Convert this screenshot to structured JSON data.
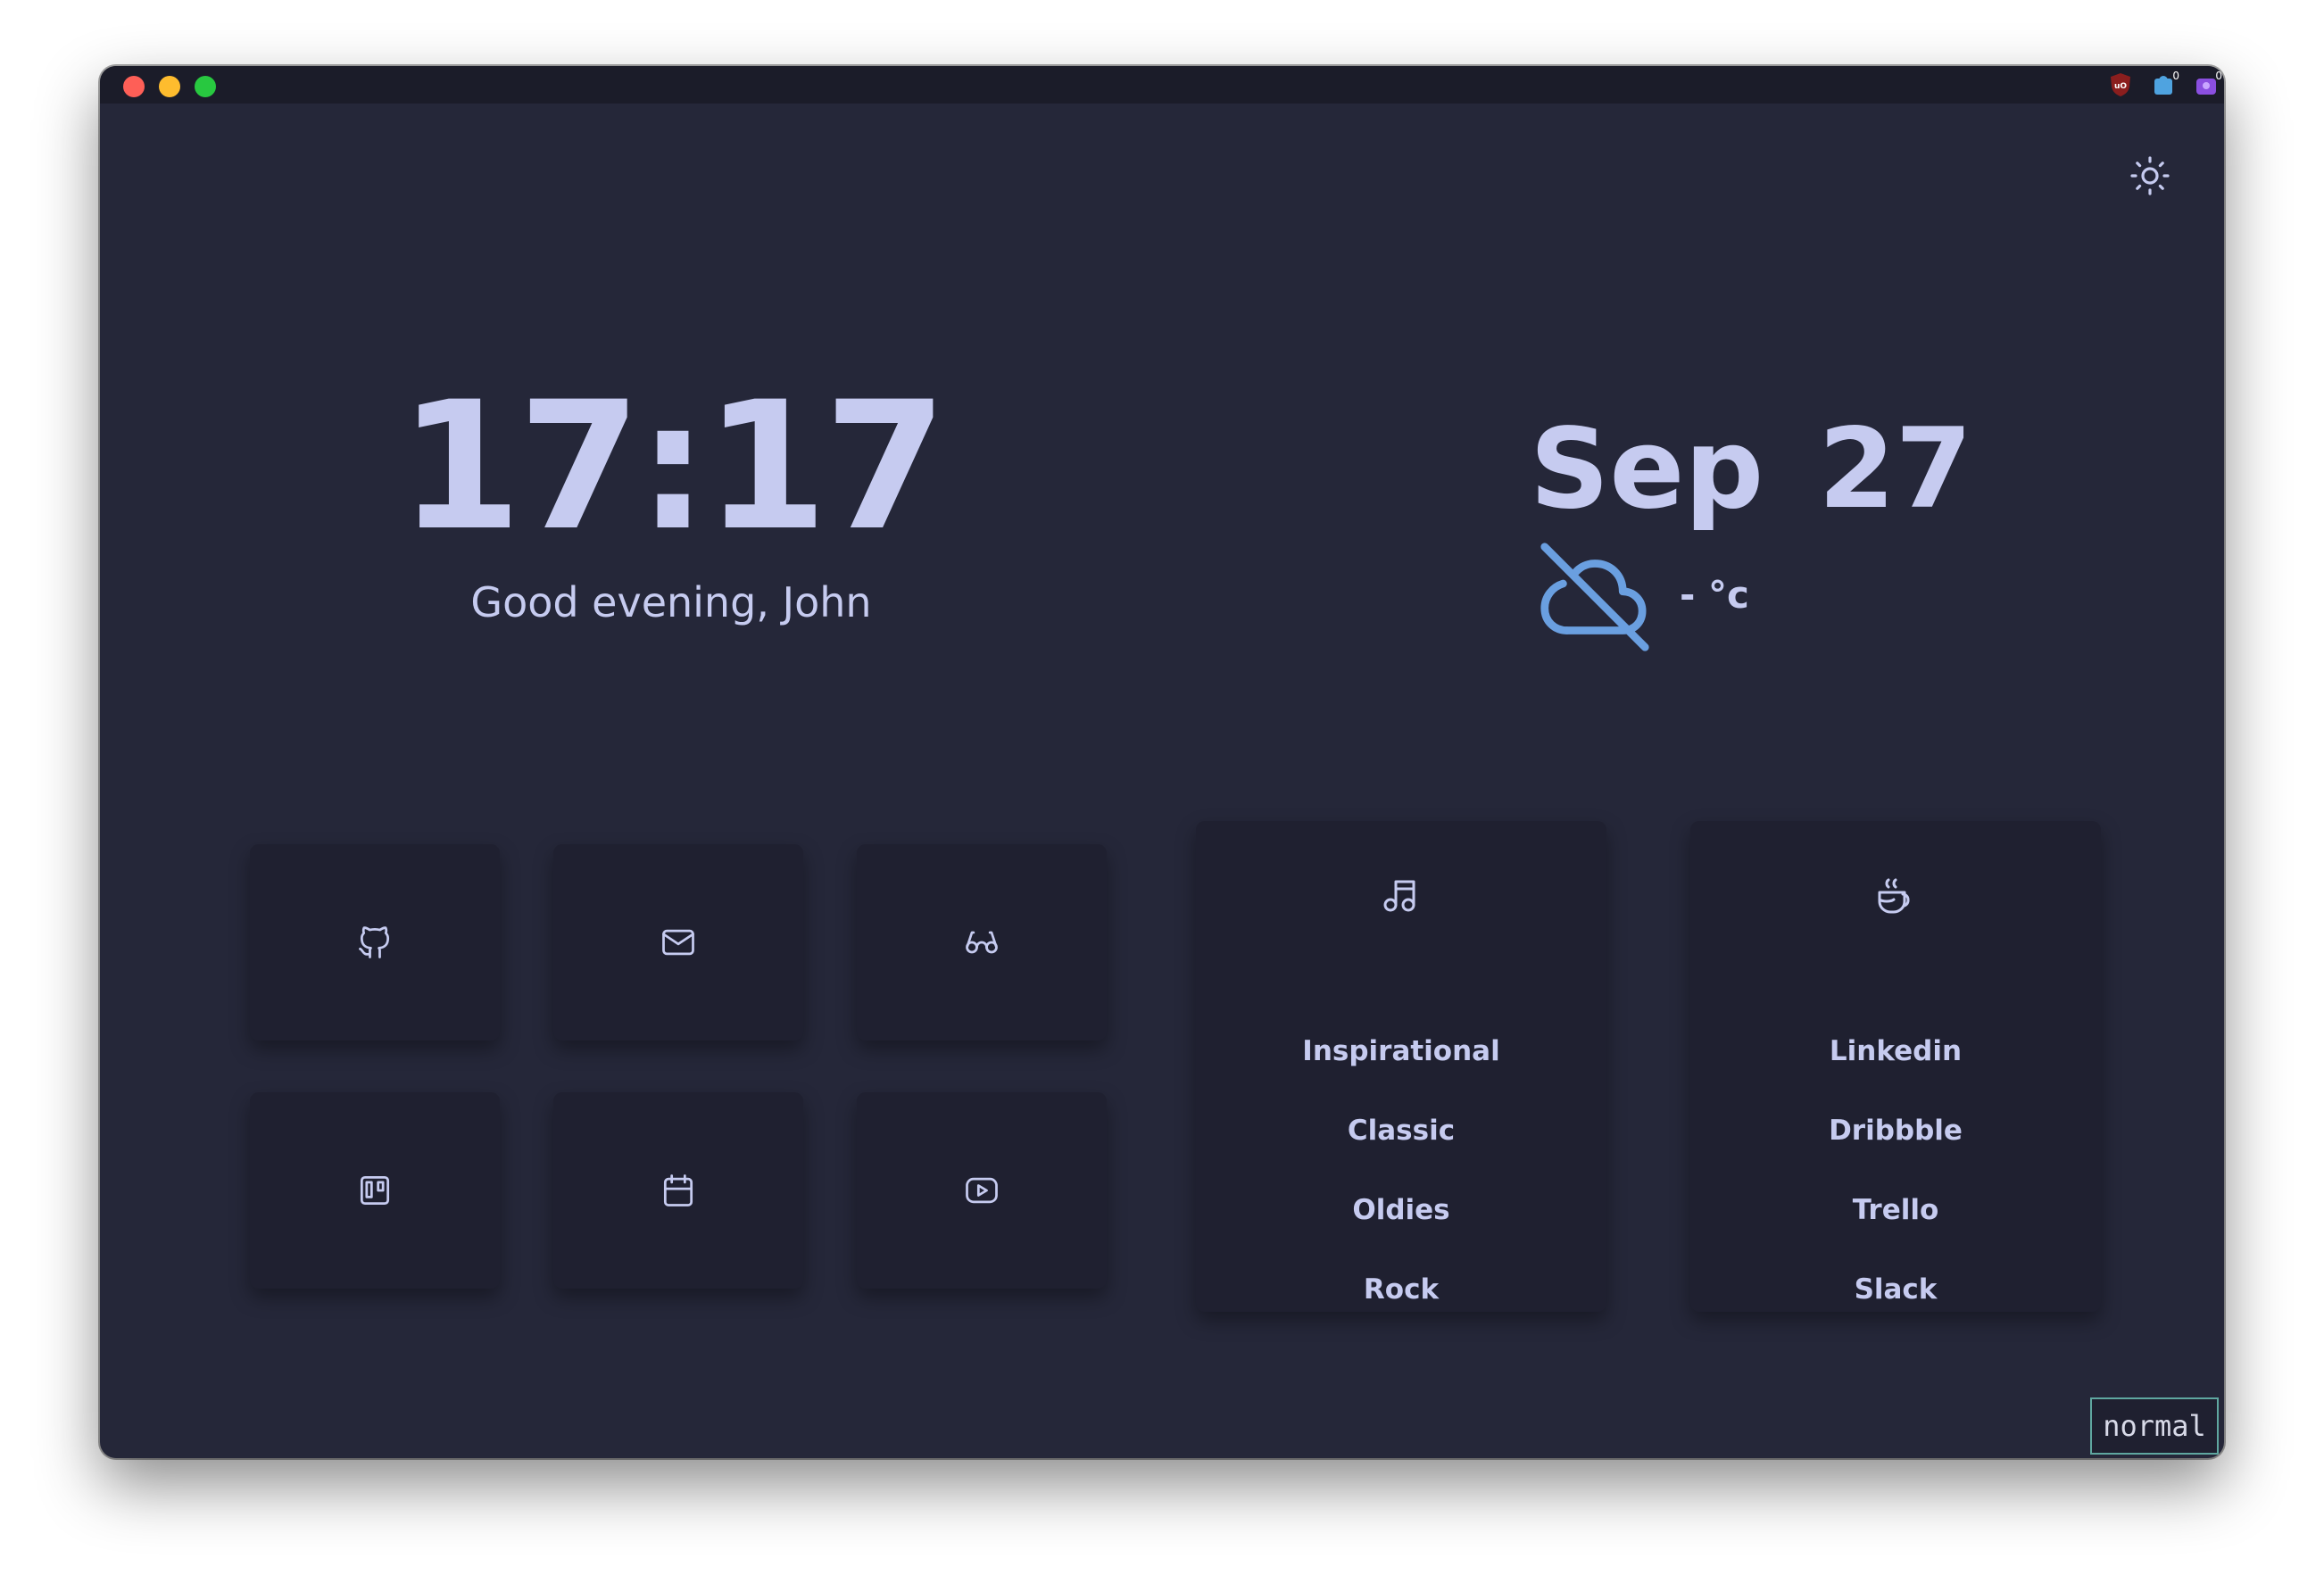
{
  "window": {
    "traffic_lights": [
      "close",
      "minimize",
      "zoom"
    ]
  },
  "extensions": [
    {
      "icon": "ublock-shield-icon",
      "badge": ""
    },
    {
      "icon": "blue-extension-icon",
      "badge": "0"
    },
    {
      "icon": "purple-extension-icon",
      "badge": "0"
    }
  ],
  "theme_toggle": {
    "icon": "sun-icon"
  },
  "clock": {
    "time": "17:17",
    "greeting": "Good evening, John"
  },
  "weather": {
    "date": "Sep 27",
    "icon": "cloud-off-icon",
    "temperature": "- °c"
  },
  "shortcuts": [
    {
      "icon": "github-icon"
    },
    {
      "icon": "mail-icon"
    },
    {
      "icon": "glasses-icon"
    },
    {
      "icon": "trello-icon"
    },
    {
      "icon": "calendar-icon"
    },
    {
      "icon": "youtube-icon"
    }
  ],
  "music_card": {
    "icon": "music-note-icon",
    "items": [
      "Inspirational",
      "Classic",
      "Oldies",
      "Rock"
    ]
  },
  "work_card": {
    "icon": "coffee-cup-icon",
    "items": [
      "Linkedin",
      "Dribbble",
      "Trello",
      "Slack"
    ]
  },
  "mode_indicator": "normal",
  "colors": {
    "background": "#252739",
    "tile": "#1f2030",
    "text": "#c6cbf0",
    "weather_icon": "#6a9fe0",
    "mode_border": "#5fa7a0"
  }
}
